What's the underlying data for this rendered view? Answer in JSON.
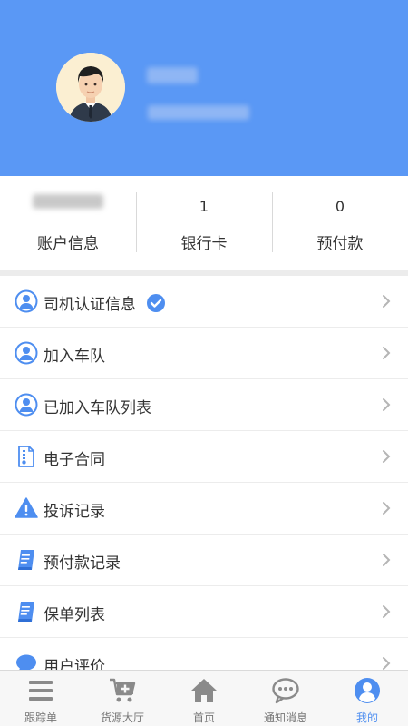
{
  "profile": {
    "name": "",
    "phone": ""
  },
  "stats": [
    {
      "value": "",
      "label": "账户信息"
    },
    {
      "value": "1",
      "label": "银行卡"
    },
    {
      "value": "0",
      "label": "预付款"
    }
  ],
  "menu": [
    {
      "label": "司机认证信息",
      "icon": "user-circle-icon",
      "verified": true
    },
    {
      "label": "加入车队",
      "icon": "user-circle-icon"
    },
    {
      "label": "已加入车队列表",
      "icon": "user-circle-icon"
    },
    {
      "label": "电子合同",
      "icon": "document-icon"
    },
    {
      "label": "投诉记录",
      "icon": "warning-icon"
    },
    {
      "label": "预付款记录",
      "icon": "book-icon"
    },
    {
      "label": "保单列表",
      "icon": "book-icon"
    },
    {
      "label": "用户评价",
      "icon": "chat-icon"
    }
  ],
  "tabs": [
    {
      "label": "跟踪单",
      "icon": "list-icon",
      "active": false
    },
    {
      "label": "货源大厅",
      "icon": "cart-icon",
      "active": false
    },
    {
      "label": "首页",
      "icon": "home-icon",
      "active": false
    },
    {
      "label": "通知消息",
      "icon": "message-icon",
      "active": false
    },
    {
      "label": "我的",
      "icon": "user-icon",
      "active": true
    }
  ],
  "colors": {
    "header": "#5a98f5",
    "accent": "#4e8ef0",
    "tab_inactive": "#777777"
  }
}
